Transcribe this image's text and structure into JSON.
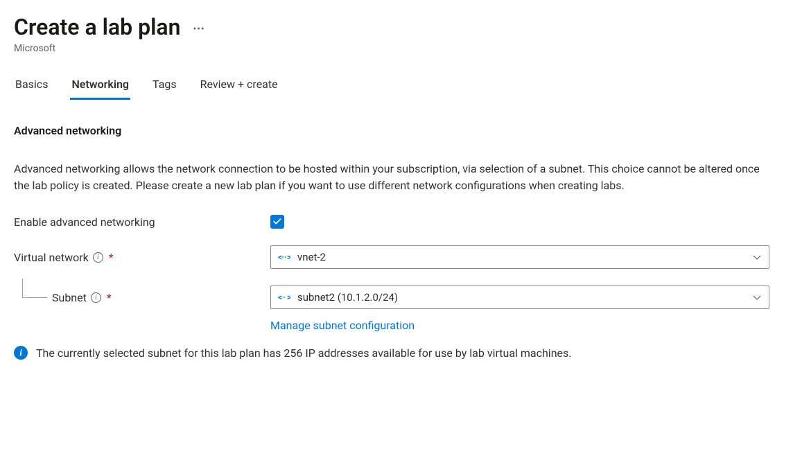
{
  "header": {
    "title": "Create a lab plan",
    "subtitle": "Microsoft"
  },
  "tabs": {
    "basics": "Basics",
    "networking": "Networking",
    "tags": "Tags",
    "review": "Review + create"
  },
  "section": {
    "title": "Advanced networking",
    "description": "Advanced networking allows the network connection to be hosted within your subscription, via selection of a subnet. This choice cannot be altered once the lab policy is created. Please create a new lab plan if you want to use different network configurations when creating labs."
  },
  "form": {
    "enable_label": "Enable advanced networking",
    "vnet_label": "Virtual network",
    "vnet_value": "vnet-2",
    "subnet_label": "Subnet",
    "subnet_value": "subnet2 (10.1.2.0/24)",
    "manage_link": "Manage subnet configuration"
  },
  "info_message": "The currently selected subnet for this lab plan has 256 IP addresses available for use by lab virtual machines."
}
